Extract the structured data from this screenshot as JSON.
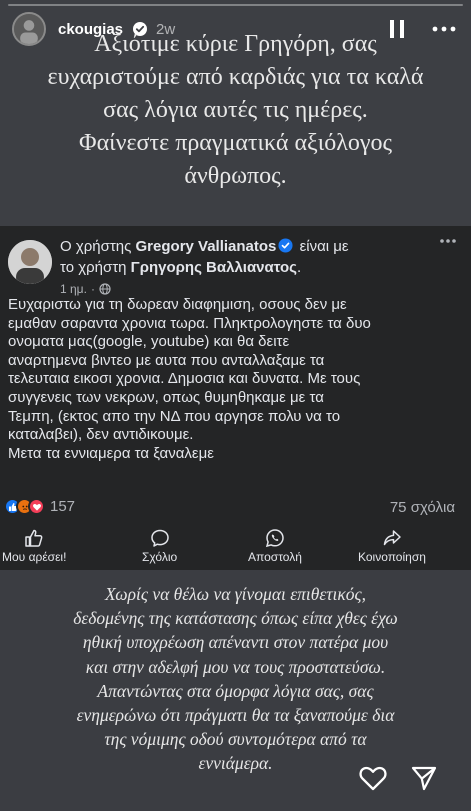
{
  "story": {
    "username": "ckougias",
    "time": "2w",
    "top_quote_lines": [
      "Αξιότιμε κύριε Γρηγόρη, σας",
      "ευχαριστούμε από καρδιάς για τα καλά",
      "σας λόγια αυτές τις ημέρες.",
      "Φαίνεστε πραγματικά αξιόλογος",
      "άνθρωπος."
    ],
    "bottom_quote_lines": [
      "Χωρίς να θέλω να γίνομαι επιθετικός,",
      "δεδομένης της κατάστασης όπως είπα χθες έχω",
      "ηθική υποχρέωση απέναντι στον πατέρα μου",
      "και στην αδελφή μου να τους προστατεύσω.",
      "Απαντώντας στα όμορφα λόγια σας, σας",
      "ενημερώνω ότι πράγματι θα τα ξαναπούμε δια",
      "της νόμιμης οδού συντομότερα από τα",
      "εννιάμερα."
    ]
  },
  "post": {
    "head_prefix": "Ο χρήστης ",
    "author": "Gregory Vallianatos",
    "head_middle": " είναι με",
    "head_line2_prefix": "το χρήστη ",
    "tagged": "Γρηγορης Βαλλιανατος",
    "head_suffix": ".",
    "time": "1 ημ.",
    "dot": "·",
    "body_lines": [
      "Ευχαριστω για τη δωρεαν διαφημιση, οσους δεν με",
      "εμαθαν σαραντα χρονια τωρα. Πληκτρολογηστε τα δυο",
      "ονοματα μας(google, youtube) και θα δειτε",
      "αναρτημενα βιντεο με αυτα που ανταλλαξαμε τα",
      "τελευταια εικοσι χρονια. Δημοσια και δυνατα. Με τους",
      "συγγενεις των νεκρων, οπως θυμηθηκαμε με τα",
      "Τεμπη, (εκτος απο την ΝΔ που αργησε πολυ να το",
      "καταλαβει), δεν αντιδικουμε.",
      "Μετα τα εννιαμερα τα ξαναλεμε"
    ],
    "reaction_count": "157",
    "comments": "75 σχόλια",
    "actions": {
      "like": "Μου αρέσει!",
      "comment": "Σχόλιο",
      "send": "Αποστολή",
      "share": "Κοινοποίηση"
    }
  },
  "icons": {
    "verified": "verified-badge-icon",
    "pause": "pause-icon",
    "more": "more-icon",
    "heart": "heart-icon",
    "send": "send-icon"
  },
  "colors": {
    "story_bg": "#3d3f44",
    "card_bg": "#242526",
    "like_blue": "#1877f2",
    "love_red": "#f33e58",
    "angry_orange": "#e9710f"
  }
}
